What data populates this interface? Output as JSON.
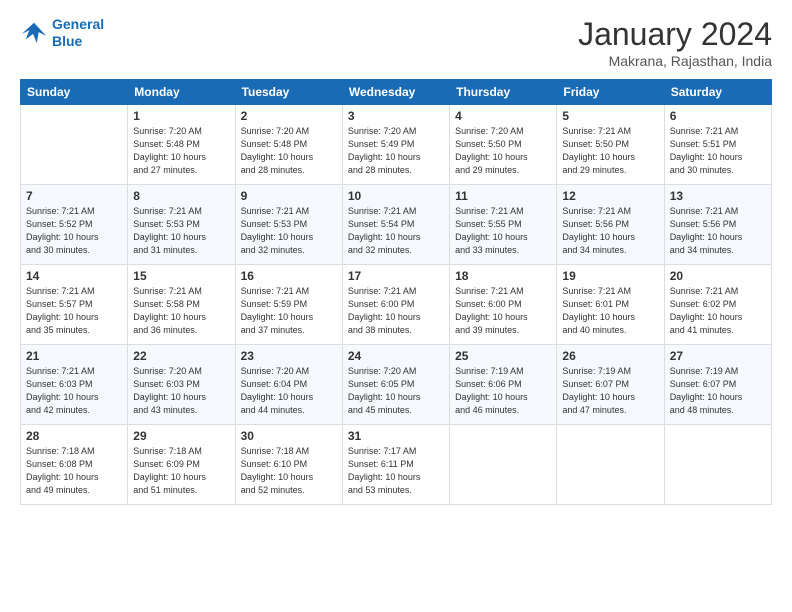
{
  "logo": {
    "line1": "General",
    "line2": "Blue"
  },
  "title": "January 2024",
  "subtitle": "Makrana, Rajasthan, India",
  "days": [
    "Sunday",
    "Monday",
    "Tuesday",
    "Wednesday",
    "Thursday",
    "Friday",
    "Saturday"
  ],
  "weeks": [
    [
      {
        "date": "",
        "info": ""
      },
      {
        "date": "1",
        "info": "Sunrise: 7:20 AM\nSunset: 5:48 PM\nDaylight: 10 hours\nand 27 minutes."
      },
      {
        "date": "2",
        "info": "Sunrise: 7:20 AM\nSunset: 5:48 PM\nDaylight: 10 hours\nand 28 minutes."
      },
      {
        "date": "3",
        "info": "Sunrise: 7:20 AM\nSunset: 5:49 PM\nDaylight: 10 hours\nand 28 minutes."
      },
      {
        "date": "4",
        "info": "Sunrise: 7:20 AM\nSunset: 5:50 PM\nDaylight: 10 hours\nand 29 minutes."
      },
      {
        "date": "5",
        "info": "Sunrise: 7:21 AM\nSunset: 5:50 PM\nDaylight: 10 hours\nand 29 minutes."
      },
      {
        "date": "6",
        "info": "Sunrise: 7:21 AM\nSunset: 5:51 PM\nDaylight: 10 hours\nand 30 minutes."
      }
    ],
    [
      {
        "date": "7",
        "info": "Sunrise: 7:21 AM\nSunset: 5:52 PM\nDaylight: 10 hours\nand 30 minutes."
      },
      {
        "date": "8",
        "info": "Sunrise: 7:21 AM\nSunset: 5:53 PM\nDaylight: 10 hours\nand 31 minutes."
      },
      {
        "date": "9",
        "info": "Sunrise: 7:21 AM\nSunset: 5:53 PM\nDaylight: 10 hours\nand 32 minutes."
      },
      {
        "date": "10",
        "info": "Sunrise: 7:21 AM\nSunset: 5:54 PM\nDaylight: 10 hours\nand 32 minutes."
      },
      {
        "date": "11",
        "info": "Sunrise: 7:21 AM\nSunset: 5:55 PM\nDaylight: 10 hours\nand 33 minutes."
      },
      {
        "date": "12",
        "info": "Sunrise: 7:21 AM\nSunset: 5:56 PM\nDaylight: 10 hours\nand 34 minutes."
      },
      {
        "date": "13",
        "info": "Sunrise: 7:21 AM\nSunset: 5:56 PM\nDaylight: 10 hours\nand 34 minutes."
      }
    ],
    [
      {
        "date": "14",
        "info": "Sunrise: 7:21 AM\nSunset: 5:57 PM\nDaylight: 10 hours\nand 35 minutes."
      },
      {
        "date": "15",
        "info": "Sunrise: 7:21 AM\nSunset: 5:58 PM\nDaylight: 10 hours\nand 36 minutes."
      },
      {
        "date": "16",
        "info": "Sunrise: 7:21 AM\nSunset: 5:59 PM\nDaylight: 10 hours\nand 37 minutes."
      },
      {
        "date": "17",
        "info": "Sunrise: 7:21 AM\nSunset: 6:00 PM\nDaylight: 10 hours\nand 38 minutes."
      },
      {
        "date": "18",
        "info": "Sunrise: 7:21 AM\nSunset: 6:00 PM\nDaylight: 10 hours\nand 39 minutes."
      },
      {
        "date": "19",
        "info": "Sunrise: 7:21 AM\nSunset: 6:01 PM\nDaylight: 10 hours\nand 40 minutes."
      },
      {
        "date": "20",
        "info": "Sunrise: 7:21 AM\nSunset: 6:02 PM\nDaylight: 10 hours\nand 41 minutes."
      }
    ],
    [
      {
        "date": "21",
        "info": "Sunrise: 7:21 AM\nSunset: 6:03 PM\nDaylight: 10 hours\nand 42 minutes."
      },
      {
        "date": "22",
        "info": "Sunrise: 7:20 AM\nSunset: 6:03 PM\nDaylight: 10 hours\nand 43 minutes."
      },
      {
        "date": "23",
        "info": "Sunrise: 7:20 AM\nSunset: 6:04 PM\nDaylight: 10 hours\nand 44 minutes."
      },
      {
        "date": "24",
        "info": "Sunrise: 7:20 AM\nSunset: 6:05 PM\nDaylight: 10 hours\nand 45 minutes."
      },
      {
        "date": "25",
        "info": "Sunrise: 7:19 AM\nSunset: 6:06 PM\nDaylight: 10 hours\nand 46 minutes."
      },
      {
        "date": "26",
        "info": "Sunrise: 7:19 AM\nSunset: 6:07 PM\nDaylight: 10 hours\nand 47 minutes."
      },
      {
        "date": "27",
        "info": "Sunrise: 7:19 AM\nSunset: 6:07 PM\nDaylight: 10 hours\nand 48 minutes."
      }
    ],
    [
      {
        "date": "28",
        "info": "Sunrise: 7:18 AM\nSunset: 6:08 PM\nDaylight: 10 hours\nand 49 minutes."
      },
      {
        "date": "29",
        "info": "Sunrise: 7:18 AM\nSunset: 6:09 PM\nDaylight: 10 hours\nand 51 minutes."
      },
      {
        "date": "30",
        "info": "Sunrise: 7:18 AM\nSunset: 6:10 PM\nDaylight: 10 hours\nand 52 minutes."
      },
      {
        "date": "31",
        "info": "Sunrise: 7:17 AM\nSunset: 6:11 PM\nDaylight: 10 hours\nand 53 minutes."
      },
      {
        "date": "",
        "info": ""
      },
      {
        "date": "",
        "info": ""
      },
      {
        "date": "",
        "info": ""
      }
    ]
  ]
}
